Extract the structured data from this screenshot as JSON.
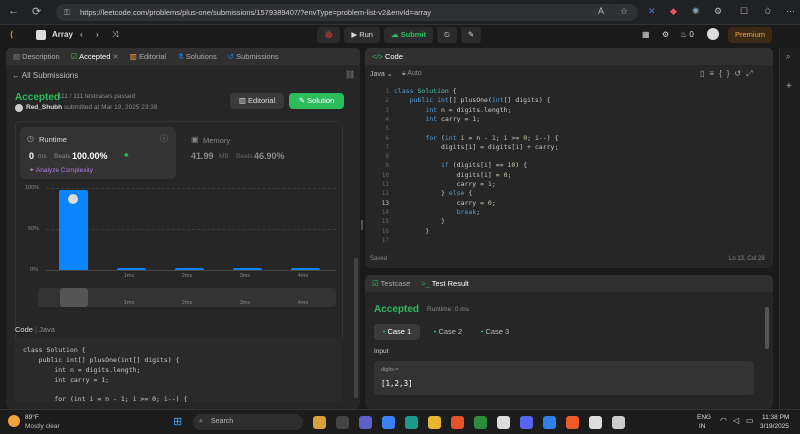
{
  "browser": {
    "url": "https://leetcode.com/problems/plus-one/submissions/1579389407/?envType=problem-list-v2&envId=array"
  },
  "header": {
    "list_title": "Array",
    "run": "Run",
    "submit": "Submit",
    "streak": "0",
    "premium": "Premium"
  },
  "left_tabs": [
    "Description",
    "Accepted",
    "Editorial",
    "Solutions",
    "Submissions"
  ],
  "submission": {
    "back": "All Submissions",
    "status": "Accepted",
    "testcases": "111 / 111 testcases passed",
    "user": "Red_Shubh",
    "submitted": "submitted at Mar 19, 2025 23:38",
    "editorial_btn": "Editorial",
    "solution_btn": "Solution"
  },
  "runtime": {
    "label": "Runtime",
    "value": "0",
    "unit": "ms",
    "beats_label": "Beats",
    "beats": "100.00%",
    "analyze": "Analyze Complexity"
  },
  "memory": {
    "label": "Memory",
    "value": "41.99",
    "unit": "MB",
    "beats_label": "Beats",
    "beats": "46.90%"
  },
  "chart_data": {
    "type": "bar",
    "y_ticks": [
      "100%",
      "50%",
      "0%"
    ],
    "categories": [
      "0ms",
      "1ms",
      "2ms",
      "3ms",
      "4ms"
    ],
    "values": [
      97,
      2,
      2,
      2,
      2
    ],
    "ylim": [
      0,
      100
    ],
    "mini_labels": [
      "1ms",
      "2ms",
      "3ms",
      "4ms"
    ]
  },
  "left_code": {
    "label": "Code",
    "lang": "Java",
    "lines": [
      "class Solution {",
      "    public int[] plusOne(int[] digits) {",
      "        int n = digits.length;",
      "        int carry = 1;",
      "",
      "        for (int i = n - 1; i >= 0; i--) {"
    ]
  },
  "editor": {
    "title": "Code",
    "lang": "Java",
    "mode": "Auto",
    "saved": "Saved",
    "cursor": "Ln 13, Col 28",
    "lines": [
      "class Solution {",
      "    public int[] plusOne(int[] digits) {",
      "        int n = digits.length;",
      "        int carry = 1;",
      "",
      "        for (int i = n - 1; i >= 0; i--) {",
      "            digits[i] = digits[i] + carry;",
      "",
      "            if (digits[i] == 10) {",
      "                digits[i] = 0;",
      "                carry = 1;",
      "            } else {",
      "                carry = 0;",
      "                break;",
      "            }",
      "        }",
      ""
    ]
  },
  "result": {
    "tab_testcase": "Testcase",
    "tab_result": "Test Result",
    "status": "Accepted",
    "runtime": "Runtime: 0 ms",
    "cases": [
      "Case 1",
      "Case 2",
      "Case 3"
    ],
    "input_label": "Input",
    "var": "digits =",
    "value": "[1,2,3]"
  },
  "taskbar": {
    "temp": "89°F",
    "weather": "Mostly clear",
    "search": "Search",
    "lang1": "ENG",
    "lang2": "IN",
    "time": "11:38 PM",
    "date": "3/19/2025"
  },
  "colors": {
    "accent": "#2cbb5d",
    "bar": "#0a84ff",
    "premium": "#f0a43a"
  }
}
